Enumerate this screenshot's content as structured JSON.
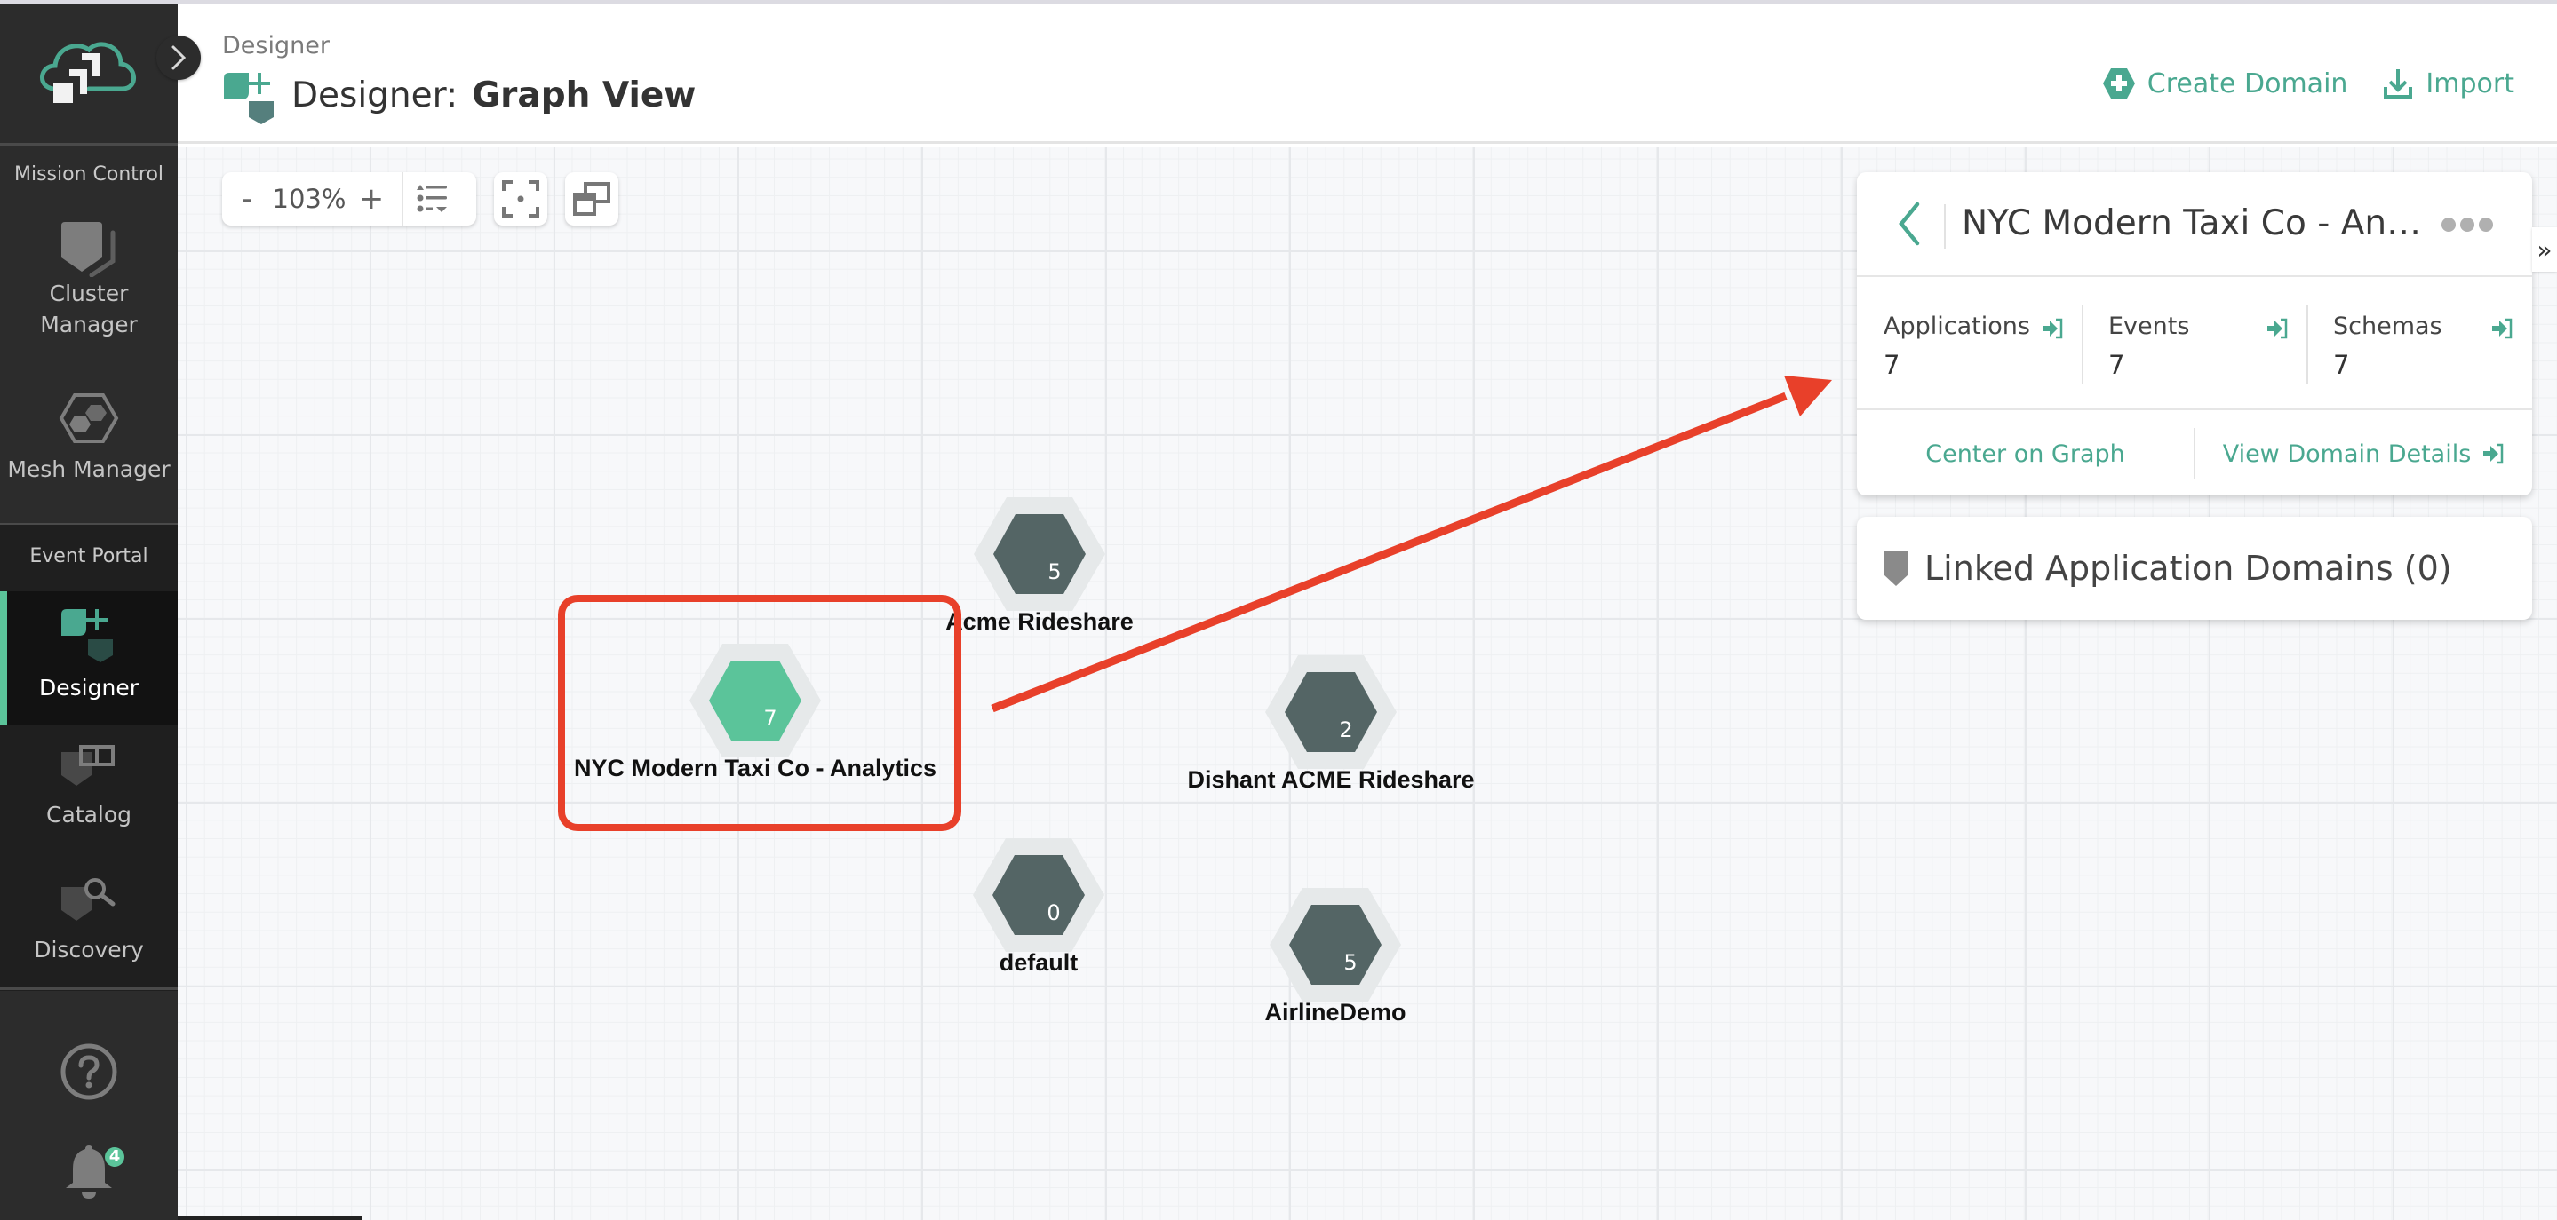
{
  "app": {
    "collapse_sidebar_icon": "chevron-right-icon"
  },
  "sidebar": {
    "sections": [
      {
        "label": "Mission Control",
        "items": [
          {
            "label_line1": "Cluster",
            "label_line2": "Manager",
            "icon": "cluster-manager-icon"
          },
          {
            "label_line1": "Mesh Manager",
            "icon": "mesh-manager-icon"
          }
        ]
      },
      {
        "label": "Event Portal",
        "items": [
          {
            "label_line1": "Designer",
            "icon": "designer-icon",
            "active": true
          },
          {
            "label_line1": "Catalog",
            "icon": "catalog-icon"
          },
          {
            "label_line1": "Discovery",
            "icon": "discovery-icon"
          }
        ]
      }
    ],
    "help_icon": "help-icon",
    "notifications": {
      "icon": "bell-icon",
      "count": "4"
    }
  },
  "header": {
    "breadcrumb": "Designer",
    "title_prefix": "Designer:",
    "title_bold": "Graph View",
    "actions": [
      {
        "label": "Create Domain",
        "icon": "create-domain-icon"
      },
      {
        "label": "Import",
        "icon": "import-icon"
      }
    ]
  },
  "toolbar": {
    "zoom_out": "-",
    "zoom_level": "103%",
    "zoom_in": "+",
    "sort_icon": "list-sort-icon",
    "fit_icon": "fit-to-screen-icon",
    "minimap_icon": "minimap-icon"
  },
  "graph": {
    "colors": {
      "selected": "#5bc49a",
      "default": "#546565",
      "halo": "#e6e9ea"
    },
    "nodes": [
      {
        "label": "NYC Modern Taxi Co - Analytics",
        "count": "7",
        "selected": true
      },
      {
        "label": "Acme Rideshare",
        "count": "5",
        "selected": false
      },
      {
        "label": "Dishant ACME Rideshare",
        "count": "2",
        "selected": false
      },
      {
        "label": "default",
        "count": "0",
        "selected": false
      },
      {
        "label": "AirlineDemo",
        "count": "5",
        "selected": false
      }
    ]
  },
  "details_panel": {
    "title": "NYC Modern Taxi Co - Analytics",
    "title_display": "NYC Modern Taxi Co - Anal...",
    "stats": [
      {
        "label": "Applications",
        "value": "7"
      },
      {
        "label": "Events",
        "value": "7"
      },
      {
        "label": "Schemas",
        "value": "7"
      }
    ],
    "actions": {
      "center": "Center on Graph",
      "view_details": "View Domain Details"
    },
    "collapse_label": "»"
  },
  "linked_domains": {
    "label": "Linked Application Domains (0)"
  },
  "annotation": {
    "color": "#e8402a"
  }
}
